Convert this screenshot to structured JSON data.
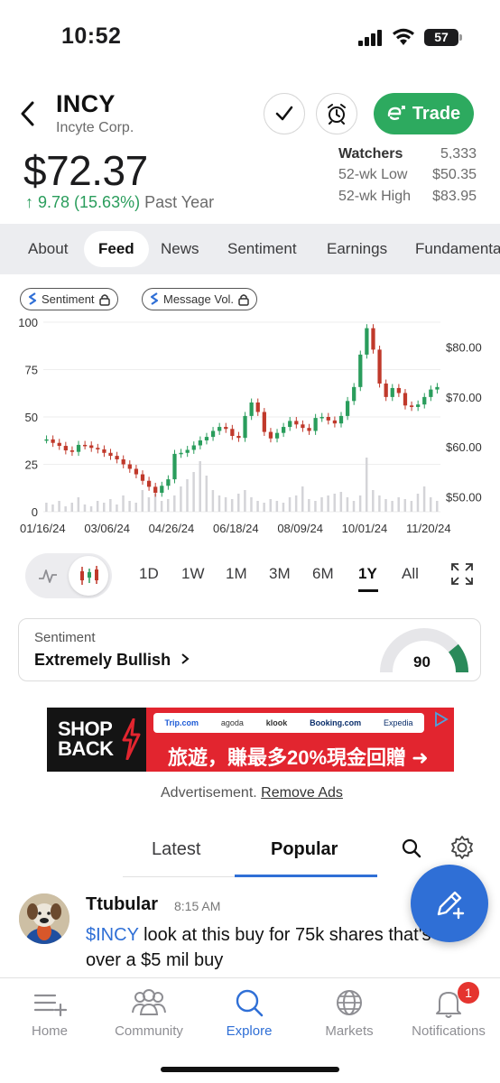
{
  "status_bar": {
    "time": "10:52",
    "battery": "57"
  },
  "header": {
    "ticker": "INCY",
    "company": "Incyte Corp.",
    "trade_label": "Trade"
  },
  "quote": {
    "price": "$72.37",
    "change": "↑ 9.78 (15.63%)",
    "period": "Past Year",
    "stats": [
      {
        "label": "Watchers",
        "value": "5,333"
      },
      {
        "label": "52-wk Low",
        "value": "$50.35"
      },
      {
        "label": "52-wk High",
        "value": "$83.95"
      }
    ]
  },
  "tabs": [
    "About",
    "Feed",
    "News",
    "Sentiment",
    "Earnings",
    "Fundamentals"
  ],
  "active_tab": "Feed",
  "chips": {
    "sentiment": "Sentiment",
    "message_volume": "Message Vol."
  },
  "chart_data": {
    "type": "line",
    "left_axis_ticks": [
      "100",
      "75",
      "50",
      "25",
      "0"
    ],
    "right_axis_ticks": [
      "$80.00",
      "$70.00",
      "$60.00",
      "$50.00"
    ],
    "x_tick_labels": [
      "01/16/24",
      "03/06/24",
      "04/26/24",
      "06/18/24",
      "08/09/24",
      "10/01/24",
      "11/20/24"
    ],
    "ylim_price": [
      47,
      85
    ],
    "series": [
      {
        "values": [
          61.5,
          60.8,
          60.2,
          59.3,
          59.0,
          60.4,
          60.3,
          59.8,
          59.5,
          58.8,
          58.2,
          57.5,
          56.5,
          55.6,
          54.5,
          53.2,
          52.0,
          50.8,
          52.2,
          53.5,
          58.6,
          58.8,
          59.4,
          60.3,
          61.3,
          62.0,
          63.2,
          64.0,
          63.6,
          62.2,
          61.8,
          66.2,
          68.9,
          67.0,
          63.0,
          61.7,
          62.8,
          64.0,
          65.2,
          64.5,
          63.8,
          63.2,
          65.8,
          66.0,
          65.3,
          64.7,
          66.2,
          69.2,
          72.0,
          78.5,
          83.8,
          79.5,
          72.7,
          70.0,
          71.8,
          70.8,
          68.3,
          68.0,
          68.5,
          70.0,
          71.5,
          72.0
        ]
      }
    ],
    "volume": [
      5,
      4,
      6,
      3,
      5,
      8,
      4,
      3,
      6,
      5,
      7,
      4,
      9,
      6,
      5,
      12,
      8,
      10,
      6,
      7,
      9,
      14,
      18,
      22,
      28,
      20,
      12,
      9,
      8,
      7,
      10,
      12,
      8,
      6,
      5,
      7,
      6,
      5,
      8,
      9,
      14,
      7,
      6,
      8,
      9,
      10,
      11,
      8,
      6,
      9,
      30,
      12,
      9,
      7,
      6,
      8,
      7,
      6,
      10,
      14,
      8,
      6
    ]
  },
  "chart_controls": {
    "ranges": [
      "1D",
      "1W",
      "1M",
      "3M",
      "6M",
      "1Y",
      "All"
    ],
    "active_range": "1Y"
  },
  "sentiment": {
    "label": "Sentiment",
    "value": "Extremely Bullish",
    "score": "90",
    "score_fraction": 0.9
  },
  "ad": {
    "brand": "SHOP BACK",
    "partners": [
      "Trip.com",
      "agoda",
      "klook",
      "Booking.com",
      "Expedia"
    ],
    "headline": "旅遊，賺最多20%現金回贈 ➜",
    "disclaimer": "Advertisement.",
    "remove_link": "Remove Ads"
  },
  "feed_tabs": {
    "latest": "Latest",
    "popular": "Popular",
    "active": "Popular"
  },
  "post": {
    "username": "Ttubular",
    "time": "8:15 AM",
    "cashtag": "$INCY",
    "text": " look at this buy for 75k shares that's over a $5 mil buy"
  },
  "bottom_nav": {
    "items": [
      "Home",
      "Community",
      "Explore",
      "Markets",
      "Notifications"
    ],
    "active": "Explore",
    "notification_badge": "1"
  },
  "colors": {
    "accent": "#2f6fd6",
    "trade_green": "#2daa5f",
    "up_green": "#2a9d5c",
    "candle_red": "#c0392b",
    "badge_red": "#e5342f"
  }
}
